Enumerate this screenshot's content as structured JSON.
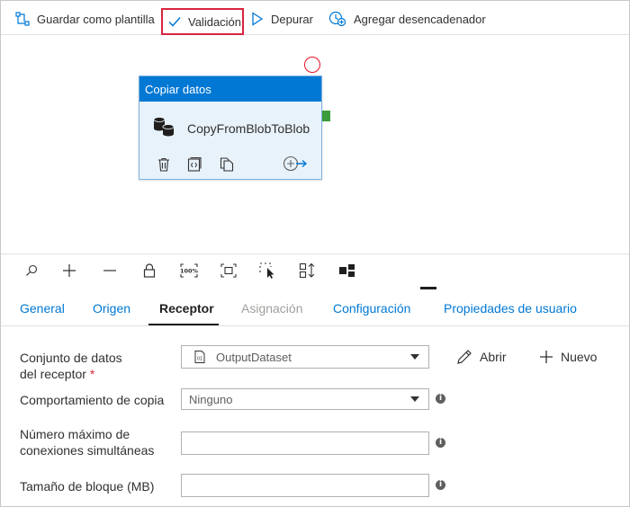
{
  "toolbar": {
    "save_template": "Guardar como plantilla",
    "validate": "Validación",
    "debug": "Depurar",
    "add_trigger": "Agregar desencadenador"
  },
  "activity": {
    "type_title": "Copiar datos",
    "name": "CopyFromBlobToBlob"
  },
  "tabs": [
    {
      "label": "General",
      "state": "normal"
    },
    {
      "label": "Origen",
      "state": "normal"
    },
    {
      "label": "Receptor",
      "state": "active"
    },
    {
      "label": "Asignación",
      "state": "disabled"
    },
    {
      "label": "Configuración",
      "state": "normal"
    },
    {
      "label": "Propiedades de usuario",
      "state": "normal"
    }
  ],
  "form": {
    "sink_dataset_label_line1": "Conjunto de datos",
    "sink_dataset_label_line2": "del receptor",
    "required_mark": "*",
    "sink_dataset_value": "OutputDataset",
    "open_label": "Abrir",
    "new_label": "Nuevo",
    "copy_behavior_label": "Comportamiento de copia",
    "copy_behavior_value": "Ninguno",
    "max_connections_label_line1": "Número máximo de",
    "max_connections_label_line2": "conexiones simultáneas",
    "max_connections_value": "",
    "block_size_label": "Tamaño de bloque (MB)",
    "block_size_value": ""
  },
  "colors": {
    "accent": "#0078d4",
    "validate_highlight": "#d7263d",
    "success_handle": "#3a9c3a",
    "error_circle": "#e81123"
  }
}
